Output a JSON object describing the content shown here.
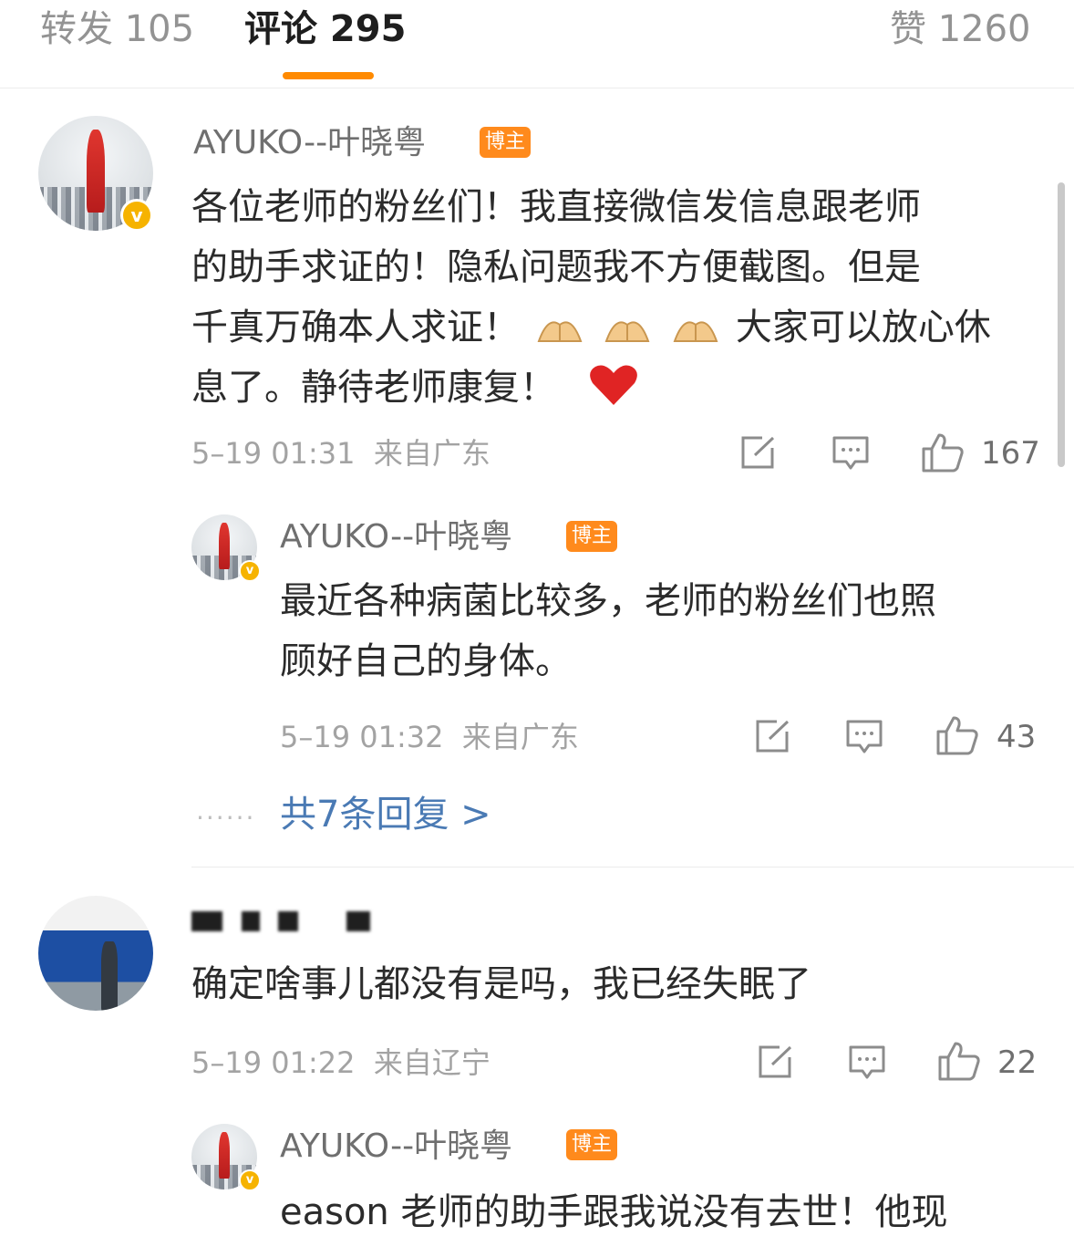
{
  "tabs": {
    "repost": "转发 105",
    "comments": "评论 295",
    "likes": "赞 1260"
  },
  "icons": {
    "hands": "folded-hands-emoji",
    "heart": "red-heart-emoji",
    "repost": "share-icon",
    "reply": "comment-icon",
    "like": "thumbs-up-icon"
  },
  "colors": {
    "accent": "#ff8a00",
    "blogger_badge": "#ff8a1c",
    "verified": "#f6b300",
    "link": "#4a7ab4"
  },
  "comment1": {
    "user": "AYUKO--叶晓粤",
    "badge": "博主",
    "verified_mark": "v",
    "line1": "各位老师的粉丝们！我直接微信发信息跟老师",
    "line2": "的助手求证的！隐私问题我不方便截图。但是",
    "line3a": "千真万确本人求证！",
    "line3b": "大家可以放心休",
    "line4": "息了。静待老师康复！",
    "time": "5–19 01:31",
    "location": "来自广东",
    "likes": "167"
  },
  "reply1": {
    "user": "AYUKO--叶晓粤",
    "badge": "博主",
    "verified_mark": "v",
    "line1": "最近各种病菌比较多，老师的粉丝们也照",
    "line2": "顾好自己的身体。",
    "time": "5–19 01:32",
    "location": "来自广东",
    "likes": "43"
  },
  "more_replies": {
    "dots": "······",
    "label": "共7条回复 >"
  },
  "comment2": {
    "text": "确定啥事儿都没有是吗，我已经失眠了",
    "time": "5–19 01:22",
    "location": "来自辽宁",
    "likes": "22"
  },
  "reply2": {
    "user": "AYUKO--叶晓粤",
    "badge": "博主",
    "verified_mark": "v",
    "line1": "eason 老师的助手跟我说没有去世！他现"
  }
}
